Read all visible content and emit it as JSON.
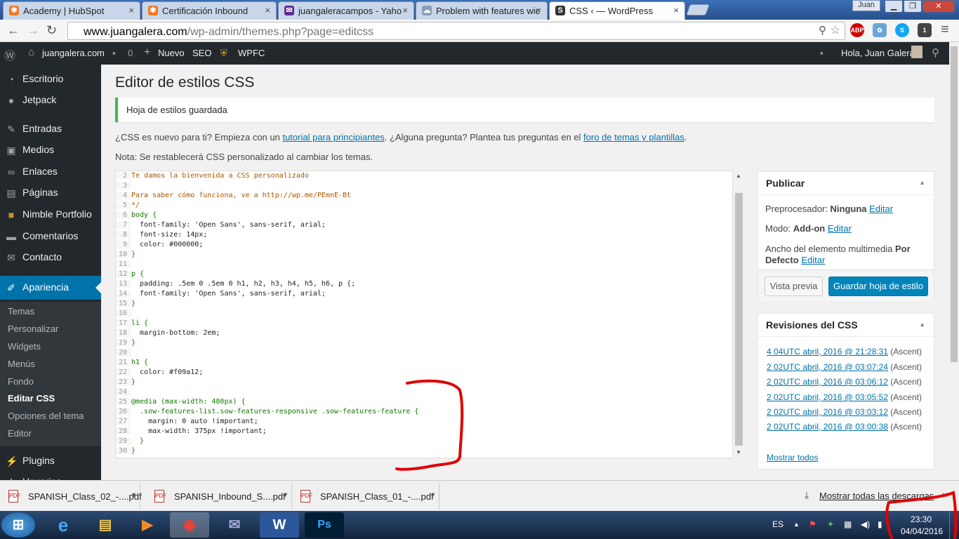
{
  "browser": {
    "tabs": [
      {
        "title": "Academy | HubSpot",
        "icon": "hubspot-icon"
      },
      {
        "title": "Certificación Inbound",
        "icon": "hubspot-icon"
      },
      {
        "title": "juangaleracampos - Yaho",
        "icon": "yahoo-mail-icon"
      },
      {
        "title": "Problem with features wic",
        "icon": "cloud-icon"
      },
      {
        "title": "CSS ‹ — WordPress",
        "icon": "wordpress-icon"
      }
    ],
    "window_user": "Juan",
    "url_domain": "www.juangalera.com",
    "url_path": "/wp-admin/themes.php?page=editcss",
    "extensions": [
      "ABP",
      "1"
    ]
  },
  "adminbar": {
    "site": "juangalera.com",
    "comments_count": "0",
    "new_label": "Nuevo",
    "seo_label": "SEO",
    "wpfc_label": "WPFC",
    "greeting": "Hola, Juan Galera"
  },
  "sidebar": {
    "items": [
      {
        "label": "Escritorio",
        "icon": "dashboard-icon"
      },
      {
        "label": "Jetpack",
        "icon": "jetpack-icon"
      },
      {
        "label": "Entradas",
        "icon": "pin-icon"
      },
      {
        "label": "Medios",
        "icon": "media-icon"
      },
      {
        "label": "Enlaces",
        "icon": "link-icon"
      },
      {
        "label": "Páginas",
        "icon": "page-icon"
      },
      {
        "label": "Nimble Portfolio",
        "icon": "portfolio-icon"
      },
      {
        "label": "Comentarios",
        "icon": "comment-icon"
      },
      {
        "label": "Contacto",
        "icon": "mail-icon"
      },
      {
        "label": "Apariencia",
        "icon": "brush-icon"
      }
    ],
    "submenu": [
      "Temas",
      "Personalizar",
      "Widgets",
      "Menús",
      "Fondo",
      "Editar CSS",
      "Opciones del tema",
      "Editor"
    ],
    "after": [
      {
        "label": "Plugins",
        "icon": "plugin-icon"
      },
      {
        "label": "Usuarios",
        "icon": "user-icon"
      }
    ]
  },
  "page": {
    "title": "Editor de estilos CSS",
    "notice": "Hoja de estilos guardada",
    "intro_1": "¿CSS es nuevo para ti? Empieza con un ",
    "intro_link1": "tutorial para principiantes",
    "intro_2": ". ¿Alguna pregunta? Plantea tus preguntas en el ",
    "intro_link2": "foro de temas y plantillas",
    "intro_3": ".",
    "note": "Nota: Se restablecerá CSS personalizado al cambiar los temas."
  },
  "editor": {
    "lines": [
      {
        "n": "2",
        "t": "Te damos la bienvenida a CSS personalizado"
      },
      {
        "n": "3",
        "t": ""
      },
      {
        "n": "4",
        "t": "Para saber cómo funciona, ve a http://wp.me/PEmnE-Bt"
      },
      {
        "n": "5",
        "t": "*/"
      },
      {
        "n": "6",
        "t": "body {"
      },
      {
        "n": "7",
        "t": "  font-family: 'Open Sans', sans-serif, arial;"
      },
      {
        "n": "8",
        "t": "  font-size: 14px;"
      },
      {
        "n": "9",
        "t": "  color: #000000;"
      },
      {
        "n": "10",
        "t": "}"
      },
      {
        "n": "11",
        "t": ""
      },
      {
        "n": "12",
        "t": "p {"
      },
      {
        "n": "13",
        "t": "  padding: .5em 0 .5em 0 h1, h2, h3, h4, h5, h6, p {;"
      },
      {
        "n": "14",
        "t": "  font-family: 'Open Sans', sans-serif, arial;"
      },
      {
        "n": "15",
        "t": "}"
      },
      {
        "n": "16",
        "t": ""
      },
      {
        "n": "17",
        "t": "li {"
      },
      {
        "n": "18",
        "t": "  margin-bottom: 2em;"
      },
      {
        "n": "19",
        "t": "}"
      },
      {
        "n": "20",
        "t": ""
      },
      {
        "n": "21",
        "t": "h1 {"
      },
      {
        "n": "22",
        "t": "  color: #f09a12;"
      },
      {
        "n": "23",
        "t": "}"
      },
      {
        "n": "24",
        "t": ""
      },
      {
        "n": "25",
        "t": "@media (max-width: 480px) {"
      },
      {
        "n": "26",
        "t": "  .sow-features-list.sow-features-responsive .sow-features-feature {"
      },
      {
        "n": "27",
        "t": "    margin: 0 auto !important;"
      },
      {
        "n": "28",
        "t": "    max-width: 375px !important;"
      },
      {
        "n": "29",
        "t": "  }"
      },
      {
        "n": "30",
        "t": "}"
      }
    ]
  },
  "publish": {
    "title": "Publicar",
    "preproc_label": "Preprocesador: ",
    "preproc_value": "Ninguna",
    "mode_label": "Modo: ",
    "mode_value": "Add-on",
    "media_label": "Ancho del elemento multimedia ",
    "media_value_1": "Por",
    "media_value_2": "Defecto",
    "edit_link": "Editar",
    "preview_button": "Vista previa",
    "save_button": "Guardar hoja de estilo"
  },
  "revisions": {
    "title": "Revisiones del CSS",
    "items": [
      {
        "date": "4 04UTC abril, 2016 @ 21:28:31",
        "author": "(Ascent)"
      },
      {
        "date": "2 02UTC abril, 2016 @ 03:07:24",
        "author": "(Ascent)"
      },
      {
        "date": "2 02UTC abril, 2016 @ 03:06:12",
        "author": "(Ascent)"
      },
      {
        "date": "2 02UTC abril, 2016 @ 03:05:52",
        "author": "(Ascent)"
      },
      {
        "date": "2 02UTC abril, 2016 @ 03:03:12",
        "author": "(Ascent)"
      },
      {
        "date": "2 02UTC abril, 2016 @ 03:00:38",
        "author": "(Ascent)"
      }
    ],
    "show_all": "Mostrar todos"
  },
  "downloads": {
    "items": [
      "SPANISH_Class_02_-....pdf",
      "SPANISH_Inbound_S....pdf",
      "SPANISH_Class_01_-....pdf"
    ],
    "show_all": "Mostrar todas las descargas"
  },
  "taskbar": {
    "lang": "ES",
    "time": "23:30",
    "date": "04/04/2016"
  },
  "annotation_color": "#e00000",
  "accent": "#0073aa"
}
